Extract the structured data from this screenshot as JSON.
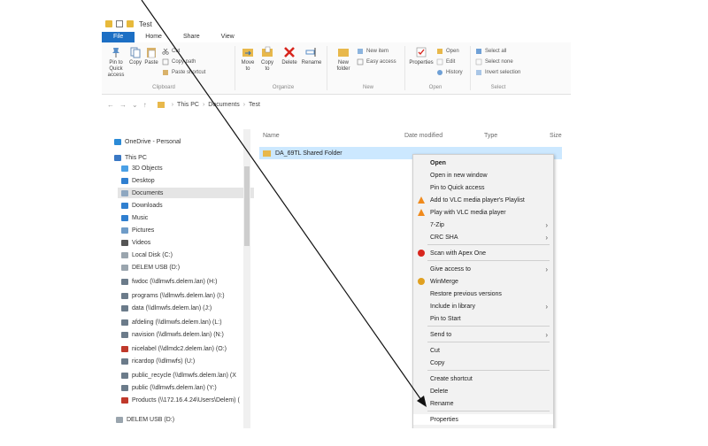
{
  "window": {
    "title": "Test",
    "tabs": [
      "File",
      "Home",
      "Share",
      "View"
    ]
  },
  "ribbon": {
    "pin_to_quick_access": "Pin to Quick access",
    "copy": "Copy",
    "paste": "Paste",
    "cut": "Cut",
    "copy_path": "Copy path",
    "paste_shortcut": "Paste shortcut",
    "move_to": "Move to",
    "copy_to": "Copy to",
    "delete": "Delete",
    "rename": "Rename",
    "new_folder": "New folder",
    "new_item": "New item",
    "easy_access": "Easy access",
    "properties": "Properties",
    "open": "Open",
    "edit": "Edit",
    "history": "History",
    "select_all": "Select all",
    "select_none": "Select none",
    "invert_selection": "Invert selection",
    "groups": {
      "clipboard": "Clipboard",
      "organize": "Organize",
      "new": "New",
      "open": "Open",
      "select": "Select"
    }
  },
  "address": {
    "crumbs": [
      "This PC",
      "Documents",
      "Test"
    ]
  },
  "navpane": {
    "items": [
      {
        "label": "OneDrive - Personal",
        "color": "#2b8ad6"
      },
      {
        "label": "This PC",
        "color": "#3a78c4"
      },
      {
        "label": "3D Objects",
        "color": "#4aa0e6"
      },
      {
        "label": "Desktop",
        "color": "#2f7fd0"
      },
      {
        "label": "Documents",
        "color": "#8ea7c0"
      },
      {
        "label": "Downloads",
        "color": "#2f7fd0"
      },
      {
        "label": "Music",
        "color": "#2f7fd0"
      },
      {
        "label": "Pictures",
        "color": "#6f9cc8"
      },
      {
        "label": "Videos",
        "color": "#555555"
      },
      {
        "label": "Local Disk (C:)",
        "color": "#9aa5ae"
      },
      {
        "label": "DELEM USB (D:)",
        "color": "#9aa5ae"
      },
      {
        "label": "fwdoc (\\\\dlmwfs.delem.lan) (H:)",
        "color": "#6b7b8a"
      },
      {
        "label": "programs (\\\\dlmwfs.delem.lan) (I:)",
        "color": "#6b7b8a"
      },
      {
        "label": "data (\\\\dlmwfs.delem.lan) (J:)",
        "color": "#6b7b8a"
      },
      {
        "label": "afdeling (\\\\dlmwfs.delem.lan) (L:)",
        "color": "#6b7b8a"
      },
      {
        "label": "navision (\\\\dlmwfs.delem.lan) (N:)",
        "color": "#6b7b8a"
      },
      {
        "label": "nicelabel (\\\\dlmdc2.delem.lan) (O:)",
        "color": "#c0392b"
      },
      {
        "label": "ricardop (\\\\dlmwfs) (U:)",
        "color": "#6b7b8a"
      },
      {
        "label": "public_recycle (\\\\dlmwfs.delem.lan) (X",
        "color": "#6b7b8a"
      },
      {
        "label": "public (\\\\dlmwfs.delem.lan) (Y:)",
        "color": "#6b7b8a"
      },
      {
        "label": "Products (\\\\172.16.4.24\\Users\\Delem) (",
        "color": "#c0392b"
      },
      {
        "label": "DELEM USB (D:)",
        "color": "#9aa5ae"
      }
    ]
  },
  "filelist": {
    "columns": [
      "Name",
      "Date modified",
      "Type",
      "Size"
    ],
    "rows": [
      {
        "name": "DA_69TL Shared Folder"
      }
    ]
  },
  "context_menu": {
    "items": [
      {
        "label": "Open",
        "bold": true
      },
      {
        "label": "Open in new window"
      },
      {
        "label": "Pin to Quick access"
      },
      {
        "label": "Add to VLC media player's Playlist",
        "icon": "vlc"
      },
      {
        "label": "Play with VLC media player",
        "icon": "vlc"
      },
      {
        "label": "7-Zip",
        "submenu": true
      },
      {
        "label": "CRC SHA",
        "submenu": true
      },
      {
        "label": "Scan with Apex One",
        "icon": "apex"
      },
      {
        "label": "Give access to",
        "submenu": true
      },
      {
        "label": "WinMerge",
        "icon": "winmerge"
      },
      {
        "label": "Restore previous versions"
      },
      {
        "label": "Include in library",
        "submenu": true
      },
      {
        "label": "Pin to Start"
      },
      {
        "label": "Send to",
        "submenu": true
      },
      {
        "label": "Cut"
      },
      {
        "label": "Copy"
      },
      {
        "label": "Create shortcut"
      },
      {
        "label": "Delete"
      },
      {
        "label": "Rename"
      },
      {
        "label": "Properties",
        "highlighted": true
      }
    ]
  },
  "colors": {
    "accent": "#1c6fc4",
    "selection": "#cce8ff",
    "folder": "#e8b84b"
  }
}
